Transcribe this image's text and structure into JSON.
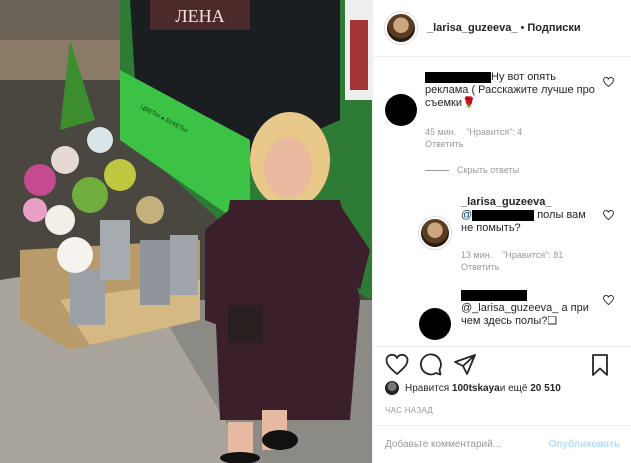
{
  "header": {
    "username": "_larisa_guzeeva_",
    "separator": "•",
    "follow_label": "Подписки"
  },
  "comments": [
    {
      "text_top": "Ну вот опять",
      "text_rest": "реклама ( Расскажите лучше про съемки🌹",
      "time": "45 мин.",
      "likes": "\"Нравится\": 4",
      "reply_label": "Ответить"
    }
  ],
  "hide_replies_label": "Скрыть ответы",
  "reply": {
    "author": "_larisa_guzeeva_",
    "mention": "@",
    "text_tail": " полы вам",
    "text_line2": "не помыть?",
    "time": "13 мин.",
    "likes": "\"Нравится\": 81",
    "reply_label": "Ответить"
  },
  "comment2": {
    "text_line1": "@_larisa_guzeeva_ а при",
    "text_line2": "чем здесь полы?❑"
  },
  "likes_text": {
    "prefix": "Нравится ",
    "user": "100tskaya",
    "suffix": " и ещё ",
    "count": "20 510"
  },
  "time_ago": "ЧАС НАЗАД",
  "add_comment": {
    "placeholder": "Добавьте комментарий...",
    "publish_label": "Опубликовать"
  },
  "photo": {
    "storefront_sign": "ЛЕНА",
    "awning_text": "ЦВЕТЫ ● БУКЕТЫ",
    "colors": {
      "dress": "#3b1f2a",
      "bus_green": "#3cc245",
      "hair": "#e8c98a"
    }
  }
}
